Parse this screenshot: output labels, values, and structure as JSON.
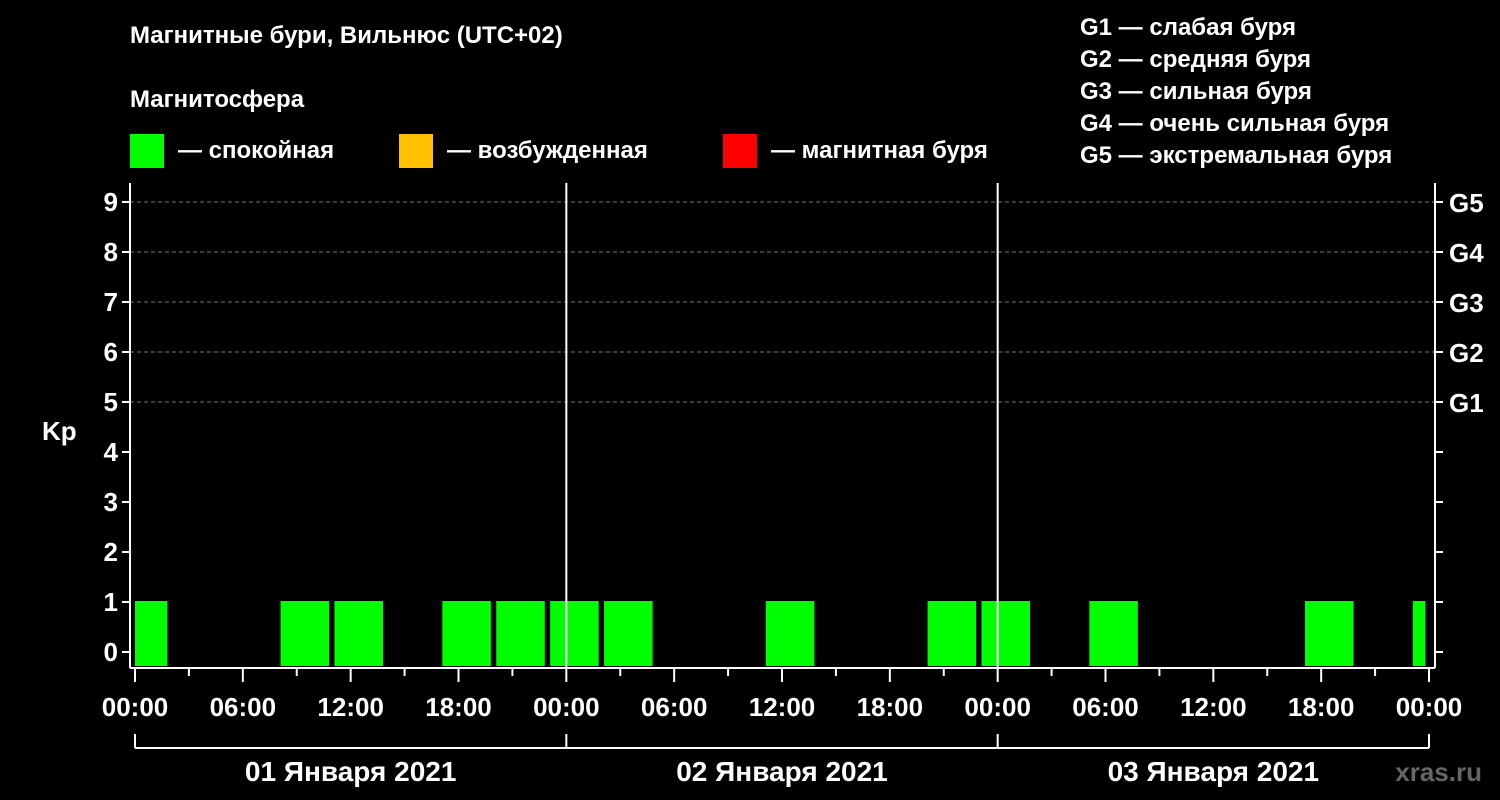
{
  "title": "Магнитные бури, Вильнюс (UTC+02)",
  "subtitle": "Магнитосфера",
  "legend": [
    {
      "label": "— спокойная",
      "color": "#00ff00"
    },
    {
      "label": "— возбужденная",
      "color": "#ffc000"
    },
    {
      "label": "— магнитная буря",
      "color": "#ff0000"
    }
  ],
  "storm_levels": [
    "G1 — слабая буря",
    "G2 — средняя буря",
    "G3 — сильная буря",
    "G4 — очень сильная буря",
    "G5 — экстремальная буря"
  ],
  "watermark": "xras.ru",
  "chart_data": {
    "type": "bar",
    "ylabel": "Kp",
    "ylim": [
      0,
      9
    ],
    "y_ticks": [
      "0",
      "1",
      "2",
      "3",
      "4",
      "5",
      "6",
      "7",
      "8",
      "9"
    ],
    "right_ticks": [
      {
        "value": 5,
        "label": "G1"
      },
      {
        "value": 6,
        "label": "G2"
      },
      {
        "value": 7,
        "label": "G3"
      },
      {
        "value": 8,
        "label": "G4"
      },
      {
        "value": 9,
        "label": "G5"
      }
    ],
    "x_range_hours": [
      0,
      72
    ],
    "x_tick_labels": [
      "00:00",
      "06:00",
      "12:00",
      "18:00",
      "00:00",
      "06:00",
      "12:00",
      "18:00",
      "00:00",
      "06:00",
      "12:00",
      "18:00",
      "00:00"
    ],
    "days": [
      "01 Января 2021",
      "02 Января 2021",
      "03 Января 2021"
    ],
    "grid": "dashed horizontal at integer Kp",
    "bars": [
      {
        "start_hour": 0,
        "end_hour": 1.8,
        "kp": 1,
        "status": "спокойная"
      },
      {
        "start_hour": 8.1,
        "end_hour": 10.8,
        "kp": 1,
        "status": "спокойная"
      },
      {
        "start_hour": 11.1,
        "end_hour": 13.8,
        "kp": 1,
        "status": "спокойная"
      },
      {
        "start_hour": 17.1,
        "end_hour": 19.8,
        "kp": 1,
        "status": "спокойная"
      },
      {
        "start_hour": 20.1,
        "end_hour": 22.8,
        "kp": 1,
        "status": "спокойная"
      },
      {
        "start_hour": 23.1,
        "end_hour": 25.8,
        "kp": 1,
        "status": "спокойная"
      },
      {
        "start_hour": 26.1,
        "end_hour": 28.8,
        "kp": 1,
        "status": "спокойная"
      },
      {
        "start_hour": 35.1,
        "end_hour": 37.8,
        "kp": 1,
        "status": "спокойная"
      },
      {
        "start_hour": 44.1,
        "end_hour": 46.8,
        "kp": 1,
        "status": "спокойная"
      },
      {
        "start_hour": 47.1,
        "end_hour": 49.8,
        "kp": 1,
        "status": "спокойная"
      },
      {
        "start_hour": 53.1,
        "end_hour": 55.8,
        "kp": 1,
        "status": "спокойная"
      },
      {
        "start_hour": 65.1,
        "end_hour": 67.8,
        "kp": 1,
        "status": "спокойная"
      },
      {
        "start_hour": 71.1,
        "end_hour": 71.8,
        "kp": 1,
        "status": "спокойная"
      }
    ]
  }
}
